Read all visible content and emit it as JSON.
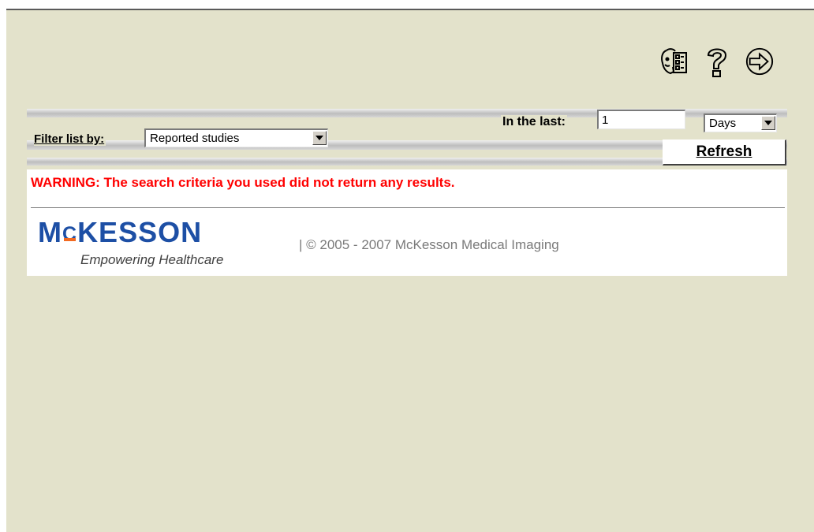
{
  "toolbar": {
    "icons": [
      "user-settings-icon",
      "help-icon",
      "logout-icon"
    ]
  },
  "filter": {
    "label": "Filter list by:",
    "selected": "Reported studies"
  },
  "last": {
    "label": "In the last:",
    "value": "1",
    "unit": "Days"
  },
  "refresh_label": "Refresh",
  "warning": "WARNING: The search criteria you used did not return any results.",
  "footer": {
    "logo_prefix": "M",
    "logo_c": "C",
    "logo_rest": "KESSON",
    "tagline": "Empowering Healthcare",
    "copyright": "| © 2005 - 2007 McKesson Medical Imaging"
  },
  "colors": {
    "background": "#e3e2cb",
    "warning": "#ff0000",
    "logo_blue": "#1d4fa5",
    "logo_orange": "#f26a21"
  }
}
